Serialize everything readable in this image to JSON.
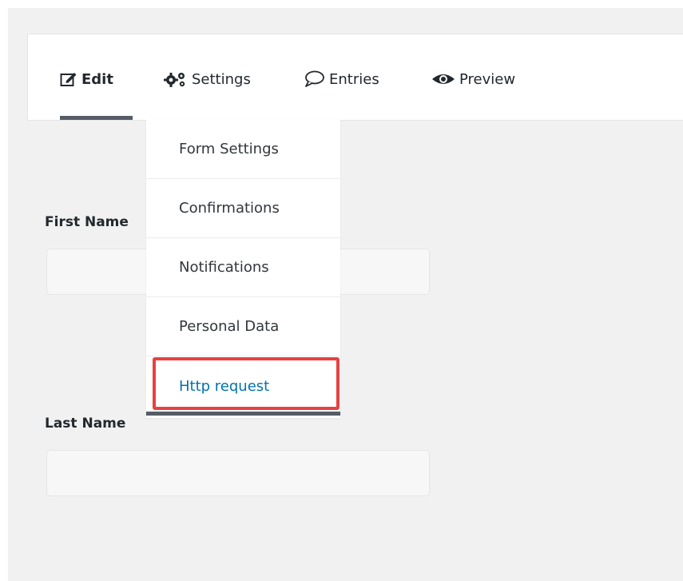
{
  "tabs": {
    "edit": {
      "label": "Edit",
      "icon": "edit-icon"
    },
    "settings": {
      "label": "Settings",
      "icon": "gears-icon"
    },
    "entries": {
      "label": "Entries",
      "icon": "speech-bubble-icon"
    },
    "preview": {
      "label": "Preview",
      "icon": "eye-icon"
    },
    "active": "edit"
  },
  "settings_menu": {
    "items": [
      {
        "label": "Form Settings"
      },
      {
        "label": "Confirmations"
      },
      {
        "label": "Notifications"
      },
      {
        "label": "Personal Data"
      },
      {
        "label": "Http request"
      }
    ],
    "highlighted": "Http request"
  },
  "form": {
    "first_name_label": "First Name",
    "last_name_label": "Last Name"
  },
  "colors": {
    "accent_link": "#0073aa",
    "highlight_border": "#e84141",
    "active_underline": "#555d66"
  }
}
